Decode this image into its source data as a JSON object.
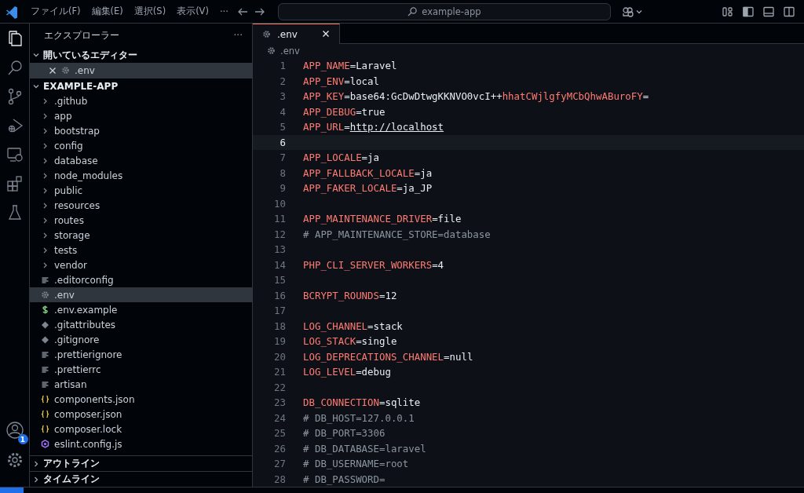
{
  "title_bar": {
    "menus": [
      "ファイル(F)",
      "編集(E)",
      "選択(S)",
      "表示(V)",
      "···"
    ],
    "search": {
      "label": "example-app"
    }
  },
  "explorer": {
    "title": "エクスプローラー",
    "more": "···",
    "open_editors": {
      "title": "開いているエディター",
      "expanded": true,
      "items": [
        {
          "label": ".env",
          "kind": "env-file",
          "selected": true
        }
      ]
    },
    "project": {
      "title": "EXAMPLE-APP",
      "expanded": true,
      "items": [
        {
          "label": ".github",
          "kind": "folder",
          "selected": false
        },
        {
          "label": "app",
          "kind": "folder",
          "selected": false
        },
        {
          "label": "bootstrap",
          "kind": "folder",
          "selected": false
        },
        {
          "label": "config",
          "kind": "folder",
          "selected": false
        },
        {
          "label": "database",
          "kind": "folder",
          "selected": false
        },
        {
          "label": "node_modules",
          "kind": "folder",
          "selected": false
        },
        {
          "label": "public",
          "kind": "folder",
          "selected": false
        },
        {
          "label": "resources",
          "kind": "folder",
          "selected": false
        },
        {
          "label": "routes",
          "kind": "folder",
          "selected": false
        },
        {
          "label": "storage",
          "kind": "folder",
          "selected": false
        },
        {
          "label": "tests",
          "kind": "folder",
          "selected": false
        },
        {
          "label": "vendor",
          "kind": "folder",
          "selected": false
        },
        {
          "label": ".editorconfig",
          "kind": "text-file",
          "selected": false
        },
        {
          "label": ".env",
          "kind": "env-file",
          "selected": true
        },
        {
          "label": ".env.example",
          "kind": "shell-file",
          "selected": false
        },
        {
          "label": ".gitattributes",
          "kind": "git-file",
          "selected": false
        },
        {
          "label": ".gitignore",
          "kind": "git-file",
          "selected": false
        },
        {
          "label": ".prettierignore",
          "kind": "text-file",
          "selected": false
        },
        {
          "label": ".prettierrc",
          "kind": "text-file",
          "selected": false
        },
        {
          "label": "artisan",
          "kind": "text-file",
          "selected": false
        },
        {
          "label": "components.json",
          "kind": "json-file",
          "selected": false
        },
        {
          "label": "composer.json",
          "kind": "json-file",
          "selected": false
        },
        {
          "label": "composer.lock",
          "kind": "json-file",
          "selected": false
        },
        {
          "label": "eslint.config.js",
          "kind": "eslint-file",
          "selected": false
        }
      ]
    },
    "sections": [
      {
        "title": "アウトライン",
        "expanded": false
      },
      {
        "title": "タイムライン",
        "expanded": false
      }
    ]
  },
  "account_badge": "1",
  "editor": {
    "tabs": [
      {
        "label": ".env",
        "selected": true
      }
    ],
    "breadcrumb": ".env",
    "lines": [
      {
        "number": "1",
        "current": false,
        "tokens": [
          {
            "kind": "key",
            "text": "APP_NAME"
          },
          {
            "kind": "value",
            "text": "=Laravel"
          }
        ]
      },
      {
        "number": "2",
        "current": false,
        "tokens": [
          {
            "kind": "key",
            "text": "APP_ENV"
          },
          {
            "kind": "value",
            "text": "=local"
          }
        ]
      },
      {
        "number": "3",
        "current": false,
        "tokens": [
          {
            "kind": "key",
            "text": "APP_KEY"
          },
          {
            "kind": "value",
            "text": "=base64:GcDwDtwgKKNVO0vcI++"
          },
          {
            "kind": "key",
            "text": "hhatCWjlgfyMCbQhwABuroFY"
          },
          {
            "kind": "value",
            "text": "="
          }
        ]
      },
      {
        "number": "4",
        "current": false,
        "tokens": [
          {
            "kind": "key",
            "text": "APP_DEBUG"
          },
          {
            "kind": "value",
            "text": "=true"
          }
        ]
      },
      {
        "number": "5",
        "current": false,
        "tokens": [
          {
            "kind": "key",
            "text": "APP_URL"
          },
          {
            "kind": "value",
            "text": "="
          },
          {
            "kind": "link",
            "text": "http://localhost"
          }
        ]
      },
      {
        "number": "6",
        "current": true
      },
      {
        "number": "7",
        "current": false,
        "tokens": [
          {
            "kind": "key",
            "text": "APP_LOCALE"
          },
          {
            "kind": "value",
            "text": "=ja"
          }
        ]
      },
      {
        "number": "8",
        "current": false,
        "tokens": [
          {
            "kind": "key",
            "text": "APP_FALLBACK_LOCALE"
          },
          {
            "kind": "value",
            "text": "=ja"
          }
        ]
      },
      {
        "number": "9",
        "current": false,
        "tokens": [
          {
            "kind": "key",
            "text": "APP_FAKER_LOCALE"
          },
          {
            "kind": "value",
            "text": "=ja_JP"
          }
        ]
      },
      {
        "number": "10",
        "current": false
      },
      {
        "number": "11",
        "current": false,
        "tokens": [
          {
            "kind": "key",
            "text": "APP_MAINTENANCE_DRIVER"
          },
          {
            "kind": "value",
            "text": "=file"
          }
        ]
      },
      {
        "number": "12",
        "current": false,
        "tokens": [
          {
            "kind": "comment",
            "text": "# APP_MAINTENANCE_STORE=database"
          }
        ]
      },
      {
        "number": "13",
        "current": false
      },
      {
        "number": "14",
        "current": false,
        "tokens": [
          {
            "kind": "key",
            "text": "PHP_CLI_SERVER_WORKERS"
          },
          {
            "kind": "value",
            "text": "=4"
          }
        ]
      },
      {
        "number": "15",
        "current": false
      },
      {
        "number": "16",
        "current": false,
        "tokens": [
          {
            "kind": "key",
            "text": "BCRYPT_ROUNDS"
          },
          {
            "kind": "value",
            "text": "=12"
          }
        ]
      },
      {
        "number": "17",
        "current": false
      },
      {
        "number": "18",
        "current": false,
        "tokens": [
          {
            "kind": "key",
            "text": "LOG_CHANNEL"
          },
          {
            "kind": "value",
            "text": "=stack"
          }
        ]
      },
      {
        "number": "19",
        "current": false,
        "tokens": [
          {
            "kind": "key",
            "text": "LOG_STACK"
          },
          {
            "kind": "value",
            "text": "=single"
          }
        ]
      },
      {
        "number": "20",
        "current": false,
        "tokens": [
          {
            "kind": "key",
            "text": "LOG_DEPRECATIONS_CHANNEL"
          },
          {
            "kind": "value",
            "text": "=null"
          }
        ]
      },
      {
        "number": "21",
        "current": false,
        "tokens": [
          {
            "kind": "key",
            "text": "LOG_LEVEL"
          },
          {
            "kind": "value",
            "text": "=debug"
          }
        ]
      },
      {
        "number": "22",
        "current": false
      },
      {
        "number": "23",
        "current": false,
        "tokens": [
          {
            "kind": "key",
            "text": "DB_CONNECTION"
          },
          {
            "kind": "value",
            "text": "=sqlite"
          }
        ]
      },
      {
        "number": "24",
        "current": false,
        "tokens": [
          {
            "kind": "comment",
            "text": "# DB_HOST=127.0.0.1"
          }
        ]
      },
      {
        "number": "25",
        "current": false,
        "tokens": [
          {
            "kind": "comment",
            "text": "# DB_PORT=3306"
          }
        ]
      },
      {
        "number": "26",
        "current": false,
        "tokens": [
          {
            "kind": "comment",
            "text": "# DB_DATABASE=laravel"
          }
        ]
      },
      {
        "number": "27",
        "current": false,
        "tokens": [
          {
            "kind": "comment",
            "text": "# DB_USERNAME=root"
          }
        ]
      },
      {
        "number": "28",
        "current": false,
        "tokens": [
          {
            "kind": "comment",
            "text": "# DB_PASSWORD="
          }
        ]
      }
    ]
  }
}
